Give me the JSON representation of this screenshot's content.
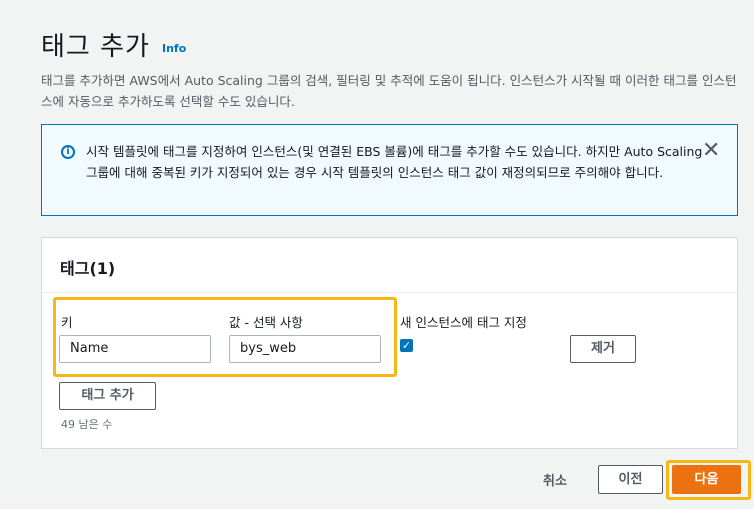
{
  "header": {
    "title": "태그 추가",
    "info_label": "Info",
    "description": "태그를 추가하면 AWS에서 Auto Scaling 그룹의 검색, 필터링 및 추적에 도움이 됩니다. 인스턴스가 시작될 때 이러한 태그를 인스턴스에 자동으로 추가하도록 선택할 수도 있습니다."
  },
  "alert": {
    "icon": "info-circle-icon",
    "text": "시작 템플릿에 태그를 지정하여 인스턴스(및 연결된 EBS 볼륨)에 태그를 추가할 수도 있습니다. 하지만 Auto Scaling 그룹에 대해 중복된 키가 지정되어 있는 경우 시작 템플릿의 인스턴스 태그 값이 재정의되므로 주의해야 합니다."
  },
  "tags": {
    "title": "태그(1)",
    "columns": {
      "key": "키",
      "value": "값 - 선택 사항",
      "propagate": "새 인스턴스에 태그 지정"
    },
    "rows": [
      {
        "key": "Name",
        "value": "bys_web",
        "propagate": true,
        "remove_label": "제거"
      }
    ],
    "add_tag_label": "태그 추가",
    "remaining": "49 남은 수"
  },
  "footer": {
    "cancel_label": "취소",
    "previous_label": "이전",
    "next_label": "다음"
  },
  "colors": {
    "primary": "#ec7211",
    "link": "#0073bb",
    "highlight": "#f8b617"
  }
}
